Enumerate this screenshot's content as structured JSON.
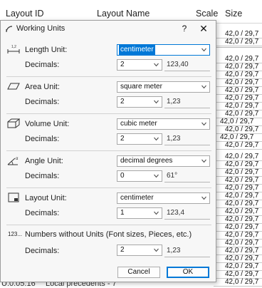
{
  "background": {
    "headers": {
      "layout_id": "Layout ID",
      "layout_name": "Layout Name",
      "scale": "Scale",
      "size": "Size"
    },
    "size_values": [
      "42,0 / 29,7",
      "42,0 / 29,7",
      "42,0 / 29,7",
      "42,0 / 29,7",
      "42,0 / 29,7",
      "42,0 / 29,7",
      "42,0 / 29,7",
      "42,0 / 29,7",
      "42,0 / 29,7",
      "42,0 / 29,7",
      "42,0 / 29,7",
      "42,0 / 29,7",
      "42,0 / 29,7",
      "42,0 / 29,7",
      "42,0 / 29,7",
      "42,0 / 29,7",
      "42,0 / 29,7",
      "42,0 / 29,7",
      "42,0 / 29,7",
      "42,0 / 29,7",
      "42,0 / 29,7",
      "42,0 / 29,7",
      "42,0 / 29,7",
      "42,0 / 29,7",
      "42,0 / 29,7",
      "42,0 / 29,7",
      "42,0 / 29,7",
      "42,0 / 29,7",
      "42,0 / 29,7",
      "42,0 / 29,7",
      "42,0 / 29,7",
      "42,0 / 29,7",
      "42,0 / 29,7",
      "42,0 / 29,7"
    ],
    "footer": {
      "id": "U.0.05.16",
      "name": "Local precedents - 7"
    }
  },
  "dialog": {
    "title": "Working Units",
    "help_label": "?",
    "close_label": "✕",
    "length": {
      "label": "Length Unit:",
      "unit": "centimeter",
      "decimals_label": "Decimals:",
      "decimals": "2",
      "example": "123,40"
    },
    "area": {
      "label": "Area Unit:",
      "unit": "square meter",
      "decimals_label": "Decimals:",
      "decimals": "2",
      "example": "1,23"
    },
    "volume": {
      "label": "Volume Unit:",
      "unit": "cubic meter",
      "decimals_label": "Decimals:",
      "decimals": "2",
      "example": "1,23"
    },
    "angle": {
      "label": "Angle Unit:",
      "unit": "decimal degrees",
      "decimals_label": "Decimals:",
      "decimals": "0",
      "example": "61°"
    },
    "layout": {
      "label": "Layout Unit:",
      "unit": "centimeter",
      "decimals_label": "Decimals:",
      "decimals": "1",
      "example": "123,4"
    },
    "numbers": {
      "icon_text": "123...",
      "label": "Numbers without Units (Font sizes, Pieces, etc.)",
      "decimals_label": "Decimals:",
      "decimals": "2",
      "example": "1,23"
    },
    "cancel_label": "Cancel",
    "ok_label": "OK",
    "accent_color": "#0078d7"
  }
}
